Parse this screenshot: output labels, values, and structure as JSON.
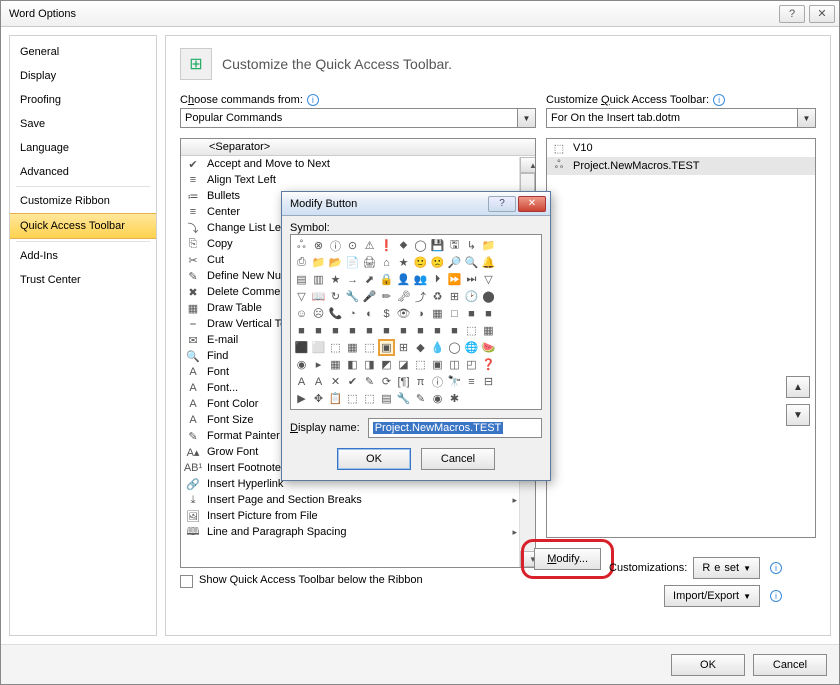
{
  "window": {
    "title": "Word Options",
    "help": "?",
    "close": "✕"
  },
  "sidebar": {
    "items": [
      {
        "label": "General"
      },
      {
        "label": "Display"
      },
      {
        "label": "Proofing"
      },
      {
        "label": "Save"
      },
      {
        "label": "Language"
      },
      {
        "label": "Advanced"
      },
      {
        "label": "Customize Ribbon"
      },
      {
        "label": "Quick Access Toolbar"
      },
      {
        "label": "Add-Ins"
      },
      {
        "label": "Trust Center"
      }
    ],
    "selected_index": 7,
    "sep_after": [
      5,
      7
    ]
  },
  "header": {
    "text": "Customize the Quick Access Toolbar."
  },
  "left": {
    "label_pre": "C",
    "label_u": "h",
    "label_post": "oose commands from:",
    "combo": "Popular Commands",
    "list_header": "<Separator>",
    "items": [
      {
        "icon": "✔",
        "label": "Accept and Move to Next"
      },
      {
        "icon": "≡",
        "label": "Align Text Left"
      },
      {
        "icon": "≔",
        "label": "Bullets",
        "sub": "▸"
      },
      {
        "icon": "≡",
        "label": "Center"
      },
      {
        "icon": "⤵",
        "label": "Change List Level",
        "sub": "▸"
      },
      {
        "icon": "⎘",
        "label": "Copy"
      },
      {
        "icon": "✂",
        "label": "Cut"
      },
      {
        "icon": "✎",
        "label": "Define New Number Format..."
      },
      {
        "icon": "✖",
        "label": "Delete Comment"
      },
      {
        "icon": "▦",
        "label": "Draw Table"
      },
      {
        "icon": "⎯",
        "label": "Draw Vertical Text Box"
      },
      {
        "icon": "✉",
        "label": "E-mail"
      },
      {
        "icon": "🔍",
        "label": "Find"
      },
      {
        "icon": "A",
        "label": "Font"
      },
      {
        "icon": "A",
        "label": "Font..."
      },
      {
        "icon": "A",
        "label": "Font Color",
        "sub": "▸"
      },
      {
        "icon": "A",
        "label": "Font Size"
      },
      {
        "icon": "✎",
        "label": "Format Painter"
      },
      {
        "icon": "A▴",
        "label": "Grow Font"
      },
      {
        "icon": "AB¹",
        "label": "Insert Footnote"
      },
      {
        "icon": "🔗",
        "label": "Insert Hyperlink"
      },
      {
        "icon": "⤓",
        "label": "Insert Page and Section Breaks",
        "sub": "▸"
      },
      {
        "icon": "🖼",
        "label": "Insert Picture from File"
      },
      {
        "icon": "🕮",
        "label": "Line and Paragraph Spacing",
        "sub": "▸"
      }
    ],
    "show_below_pre": "S",
    "show_below_u": "h",
    "show_below_post": "ow Quick Access Toolbar below the Ribbon"
  },
  "right": {
    "label_pre": "Customize ",
    "label_u": "Q",
    "label_post": "uick Access Toolbar:",
    "combo": "For On the Insert tab.dotm",
    "items": [
      {
        "icon": "⬚",
        "label": "V10"
      },
      {
        "icon": "ஃ",
        "label": "Project.NewMacros.TEST",
        "selected": true
      }
    ],
    "modify_pre": "",
    "modify_u": "M",
    "modify_post": "odify...",
    "cust_label": "Customizations:",
    "reset_pre": "R",
    "reset_u": "e",
    "reset_post": "set",
    "import_pre": "Import/Export",
    "import_u": "",
    "import_post": ""
  },
  "footer": {
    "ok": "OK",
    "cancel": "Cancel"
  },
  "dialog": {
    "title": "Modify Button",
    "symbol_label_u": "S",
    "symbol_label_post": "ymbol:",
    "rows": [
      [
        "ஃ",
        "⊗",
        "ⓘ",
        "⊙",
        "⚠",
        "❗",
        "⬥",
        "◯",
        "💾",
        "🖫",
        "↳",
        "📁"
      ],
      [
        "⎙",
        "📁",
        "📂",
        "📄",
        "🖨",
        "⌂",
        "★",
        "🙂",
        "🙁",
        "🔎",
        "🔍",
        "🔔"
      ],
      [
        "▤",
        "▥",
        "★",
        "→",
        "⬈",
        "🔒",
        "👤",
        "👥",
        "⏵",
        "⏩",
        "⏭",
        "▽"
      ],
      [
        "▽",
        "📖",
        "↻",
        "🔧",
        "🎤",
        "✏",
        "🗝",
        "⤴",
        "♻",
        "⊞",
        "🕑",
        "⬤"
      ],
      [
        "☺",
        "☹",
        "📞",
        "◔",
        "◐",
        "$",
        "👁",
        "◑",
        "▦",
        "□",
        "■",
        "■"
      ],
      [
        "■",
        "■",
        "■",
        "■",
        "■",
        "■",
        "■",
        "■",
        "■",
        "■",
        "⬚",
        "▦"
      ],
      [
        "⬛",
        "⬜",
        "⬚",
        "▦",
        "⬚",
        "▣",
        "⊞",
        "◆",
        "💧",
        "◯",
        "🌐",
        "🍉"
      ],
      [
        "◉",
        "▸",
        "▦",
        "◧",
        "◨",
        "◩",
        "◪",
        "⬚",
        "▣",
        "◫",
        "◰",
        "❓"
      ],
      [
        "A",
        "A",
        "✕",
        "✔",
        "✎",
        "⟳",
        "[¶]",
        "π",
        "ⓘ",
        "🔭",
        "≡",
        "⊟"
      ],
      [
        "▶",
        "✥",
        "📋",
        "⬚",
        "⬚",
        "▤",
        "🔧",
        "✎",
        "◉",
        "✱",
        "",
        ""
      ]
    ],
    "selected_row": 6,
    "selected_col": 5,
    "dn_label_pre": "",
    "dn_label_u": "D",
    "dn_label_post": "isplay name:",
    "dn_value": "Project.NewMacros.TEST",
    "ok": "OK",
    "cancel": "Cancel"
  }
}
